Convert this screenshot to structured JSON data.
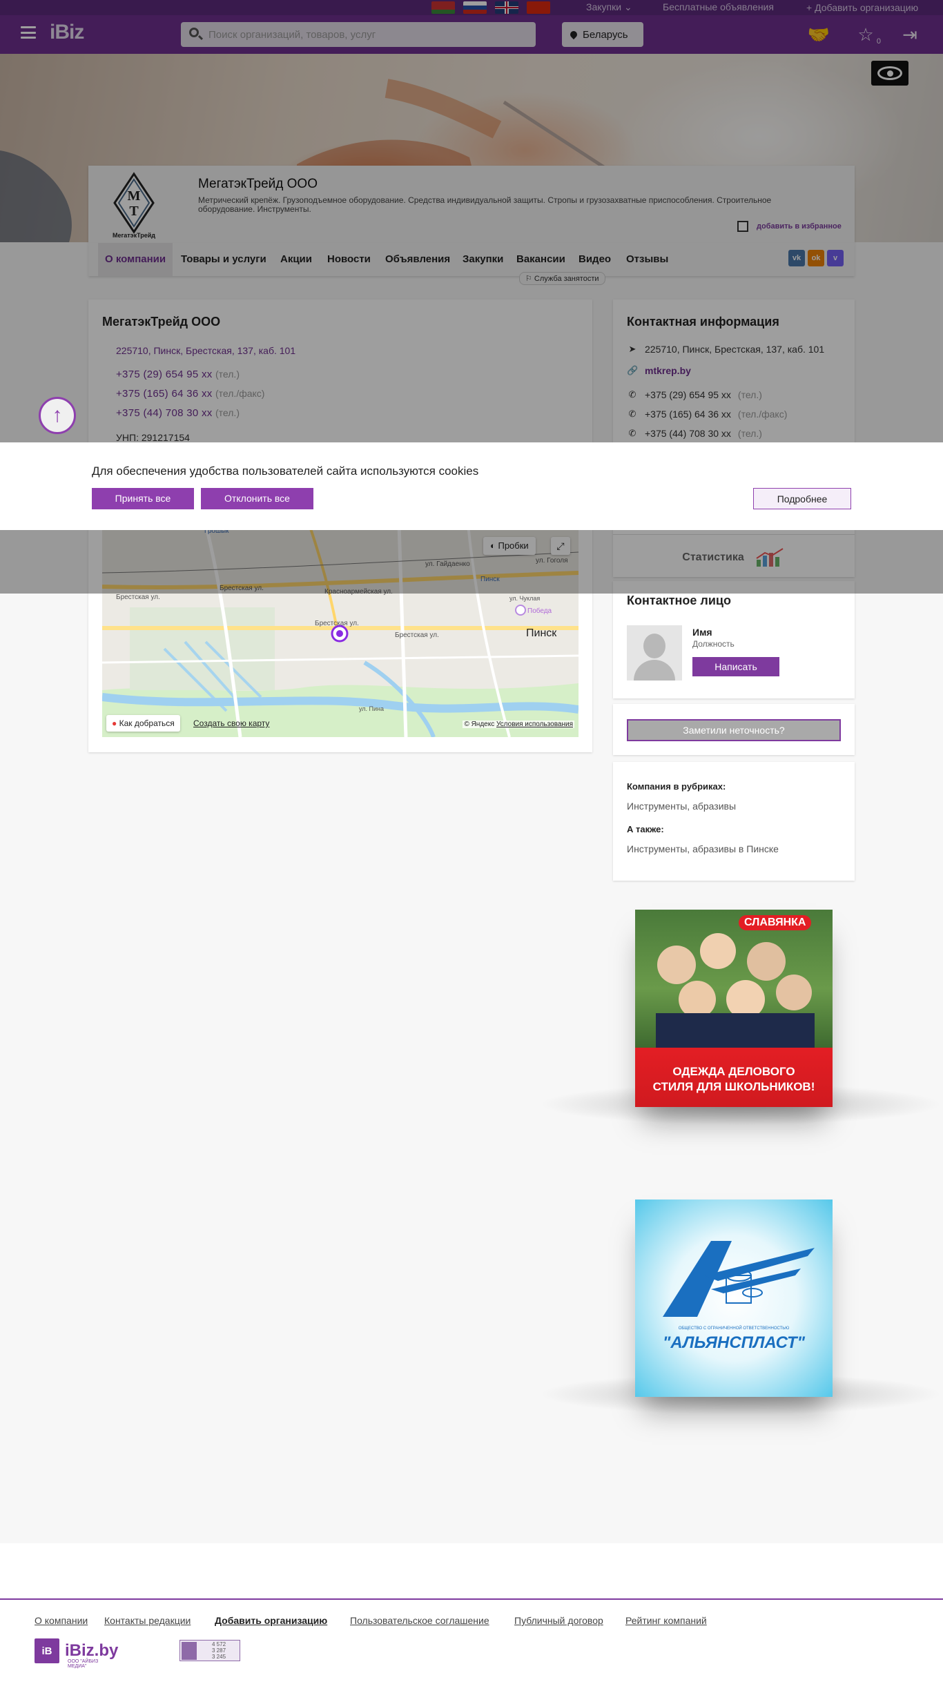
{
  "topbar": {
    "flags": [
      "belarus-flag",
      "russia-flag",
      "uk-flag",
      "china-flag"
    ],
    "zakupki": "Закупки",
    "free_ads": "Бесплатные объявления",
    "add_org": "+ Добавить организацию"
  },
  "header": {
    "logo": "iBiz",
    "search_placeholder": "Поиск организаций, товаров, услуг",
    "region": "Беларусь",
    "fav_count": "0"
  },
  "company": {
    "logo_initials_top": "М",
    "logo_initials_bottom": "Т",
    "logo_caption": "МегатэкТрейд",
    "title": "МегатэкТрейд ООО",
    "description": "Метрический крепёж. Грузоподъемное оборудование. Средства индивидуальной защиты. Стропы и грузозахватные приспособления. Строительное оборудование. Инструменты.",
    "add_favorite": "добавить в избранное"
  },
  "tabs": [
    {
      "label": "О компании"
    },
    {
      "label": "Товары и услуги"
    },
    {
      "label": "Акции"
    },
    {
      "label": "Новости"
    },
    {
      "label": "Объявления"
    },
    {
      "label": "Закупки"
    },
    {
      "label": "Вакансии"
    },
    {
      "label": "Видео"
    },
    {
      "label": "Отзывы"
    }
  ],
  "social": {
    "vk": "vk",
    "ok": "ok",
    "viber": "v"
  },
  "job_tooltip": "Служба занятости",
  "main": {
    "title": "МегатэкТрейд ООО",
    "address": "225710, Пинск, Брестская, 137, каб. 101",
    "phones": [
      {
        "number": "+375 (29) 654 95 xx",
        "type": "(тел.)"
      },
      {
        "number": "+375 (165) 64 36 xx",
        "type": "(тел./факс)"
      },
      {
        "number": "+375 (44) 708 30 xx",
        "type": "(тел.)"
      }
    ],
    "unp": "УНП: 291217154"
  },
  "map": {
    "traffic": "Пробки",
    "route": "Как добраться",
    "create": "Создать свою карту",
    "copyright": "© Яндекс",
    "terms": "Условия использования",
    "city": "Пинск",
    "labels": [
      "Брестская ул.",
      "Брестская ул.",
      "Брестская ул.",
      "Брестская ул.",
      "Красноармейская ул.",
      "ул. Гайдаенко",
      "ул. Гоголя",
      "Победа",
      "Пинск",
      "Грошык",
      "ул. Чуклая",
      "ул. Пина"
    ]
  },
  "contact": {
    "title": "Контактная информация",
    "address": "225710, Пинск, Брестская, 137, каб. 101",
    "site": "mtkrep.by",
    "phones": [
      {
        "number": "+375 (29) 654 95 xx",
        "type": "(тел.)"
      },
      {
        "number": "+375 (165) 64 36 xx",
        "type": "(тел./факс)"
      },
      {
        "number": "+375 (44) 708 30 xx",
        "type": "(тел.)"
      }
    ]
  },
  "stats": {
    "label": "Статистика"
  },
  "person": {
    "title": "Контактное лицо",
    "name": "Имя",
    "position": "Должность",
    "write": "Написать"
  },
  "report": {
    "label": "Заметили неточность?"
  },
  "rubrics": {
    "in_rubrics": "Компания в рубриках:",
    "rubric": "Инструменты, абразивы",
    "also": "А также:",
    "also_item": "Инструменты, абразивы в Пинске"
  },
  "ads": [
    {
      "brand": "СЛАВЯНКА",
      "caption_line1": "ОДЕЖДА ДЕЛОВОГО",
      "caption_line2": "СТИЛЯ ДЛЯ ШКОЛЬНИКОВ!"
    },
    {
      "brand": "\"АЛЬЯНСПЛАСТ\"",
      "small": "ОБЩЕСТВО С ОГРАНИЧЕННОЙ ОТВЕТСТВЕННОСТЬЮ"
    }
  ],
  "cookie": {
    "message": "Для обеспечения удобства пользователей сайта используются cookies",
    "accept": "Принять все",
    "decline": "Отклонить все",
    "more": "Подробнее"
  },
  "footer": {
    "links": [
      "О компании",
      "Контакты редакции",
      "Добавить организацию",
      "Пользовательское соглашение",
      "Публичный договор",
      "Рейтинг компаний"
    ],
    "logo_mark": "iB",
    "logo_name": "iBiz.by",
    "logo_sub": "ООО \"АЙБИЗ МЕДИА\"",
    "counter": [
      "4 572",
      "3 287",
      "3 245"
    ]
  },
  "colors": {
    "brand": "#6e2f8e",
    "accent": "#8e3fae",
    "header": "#6e2f8e"
  }
}
